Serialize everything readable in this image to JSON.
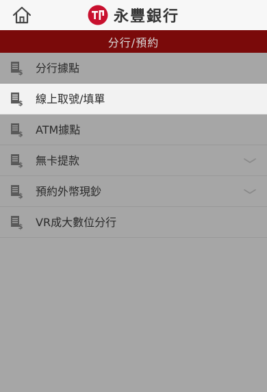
{
  "header": {
    "home_icon": "home-icon",
    "logo_icon": "bank-logo-icon",
    "bank_name": "永豐銀行"
  },
  "section": {
    "title": "分行/預約"
  },
  "menu": {
    "items": [
      {
        "label": "分行據點",
        "icon": "document-dollar-icon",
        "active": false,
        "expandable": false
      },
      {
        "label": "線上取號/填單",
        "icon": "document-dollar-icon",
        "active": true,
        "expandable": false
      },
      {
        "label": "ATM據點",
        "icon": "document-dollar-icon",
        "active": false,
        "expandable": false
      },
      {
        "label": "無卡提款",
        "icon": "document-dollar-icon",
        "active": false,
        "expandable": true
      },
      {
        "label": "預約外幣現鈔",
        "icon": "document-dollar-icon",
        "active": false,
        "expandable": true
      },
      {
        "label": "VR成大數位分行",
        "icon": "document-dollar-icon",
        "active": false,
        "expandable": false
      }
    ]
  },
  "colors": {
    "brand_red": "#7a0a0a",
    "logo_red": "#c8102e",
    "menu_bg": "#a6a6a6",
    "active_bg": "#f2f2f2"
  }
}
